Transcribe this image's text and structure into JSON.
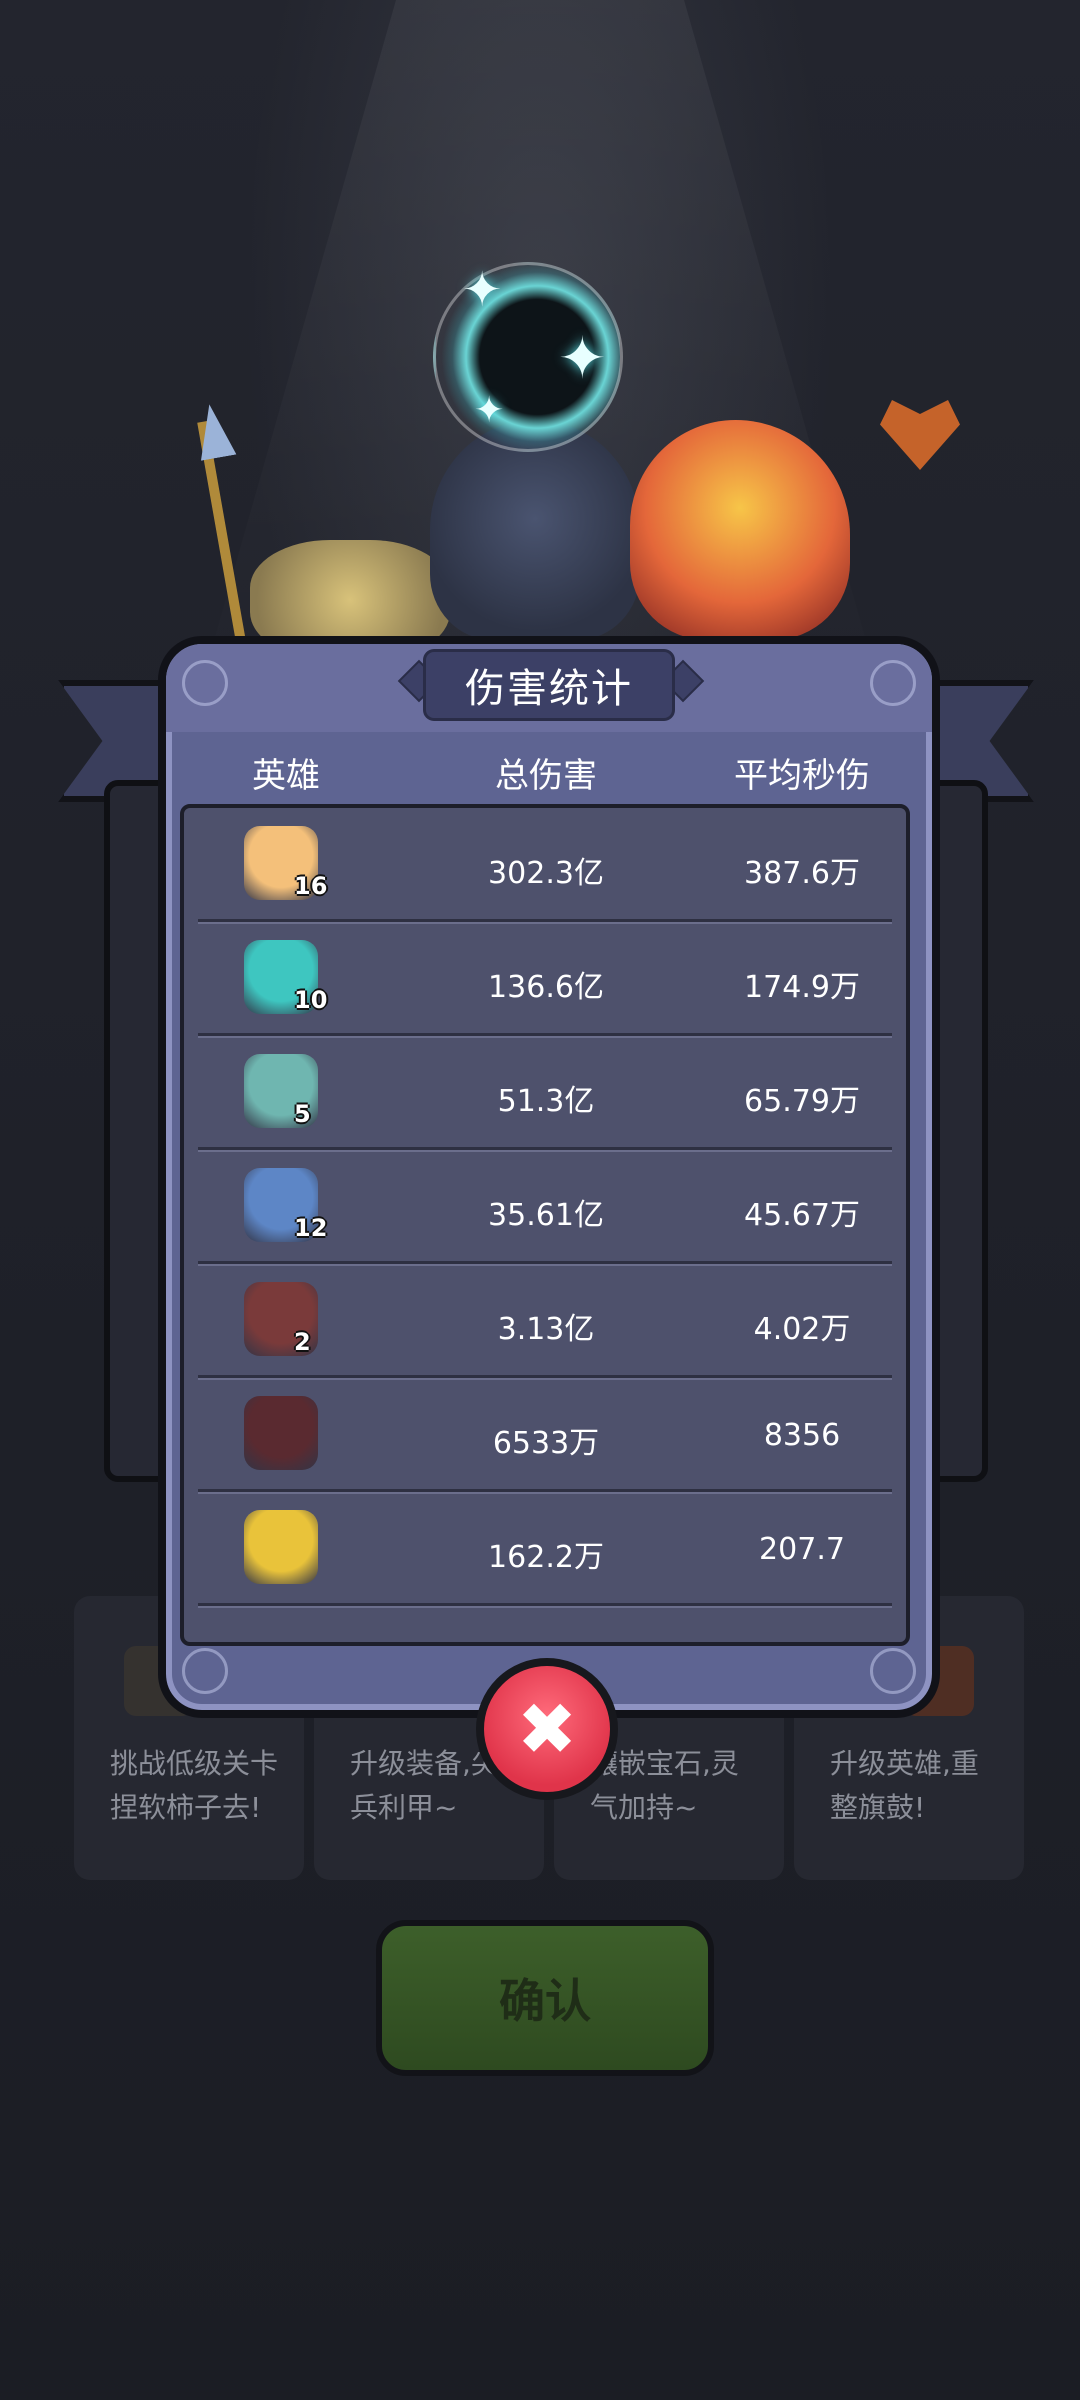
{
  "dialog": {
    "title": "伤害统计",
    "columns": {
      "hero": "英雄",
      "total": "总伤害",
      "dps": "平均秒伤"
    },
    "rows": [
      {
        "level": "16",
        "total": "302.3亿",
        "dps": "387.6万",
        "avatar_color": "#f4c07a",
        "icon": "blonde-hero-icon"
      },
      {
        "level": "10",
        "total": "136.6亿",
        "dps": "174.9万",
        "avatar_color": "#3ec6c0",
        "icon": "dragon-hero-icon"
      },
      {
        "level": "5",
        "total": "51.3亿",
        "dps": "65.79万",
        "avatar_color": "#6fb6b0",
        "icon": "owl-hero-icon"
      },
      {
        "level": "12",
        "total": "35.61亿",
        "dps": "45.67万",
        "avatar_color": "#5d86c6",
        "icon": "ice-knight-hero-icon"
      },
      {
        "level": "2",
        "total": "3.13亿",
        "dps": "4.02万",
        "avatar_color": "#7a3a3a",
        "icon": "hooded-mage-hero-icon"
      },
      {
        "level": "",
        "total": "6533万",
        "dps": "8356",
        "avatar_color": "#5a2a30",
        "icon": "demon-hero-icon"
      },
      {
        "level": "",
        "total": "162.2万",
        "dps": "207.7",
        "avatar_color": "#e9c33a",
        "icon": "golden-beast-hero-icon"
      }
    ]
  },
  "background_cards": [
    {
      "text": "挑战低级关卡捏软柿子去!"
    },
    {
      "text": "升级装备,尖兵利甲~"
    },
    {
      "text": "镶嵌宝石,灵气加持~"
    },
    {
      "text": "升级英雄,重整旗鼓!"
    }
  ],
  "buttons": {
    "close": "✖",
    "confirm": "确认"
  },
  "colors": {
    "dialog": "#5e6492",
    "table": "#4e516c",
    "close": "#e0344a",
    "confirm": "#3d5f2a"
  }
}
